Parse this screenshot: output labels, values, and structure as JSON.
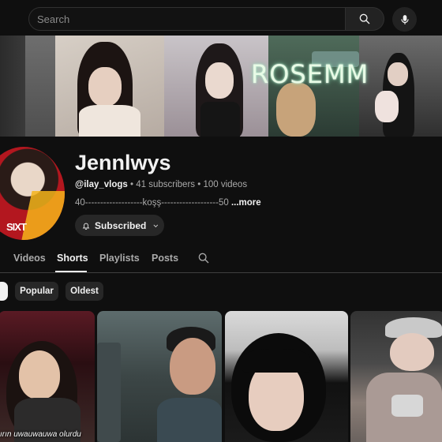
{
  "search": {
    "placeholder": "Search"
  },
  "icons": {
    "search": "search-icon",
    "mic": "mic-icon",
    "bell": "bell-icon",
    "chevron": "chevron-down-icon"
  },
  "banner": {
    "text": "ROSEMM"
  },
  "channel": {
    "name": "Jennlwys",
    "handle": "@ilay_vlogs",
    "stats": " • 41 subscribers • 100 videos",
    "description": "40-------------------koşş-------------------50 ",
    "more_label": "...more",
    "avatar_logo": "SIXT"
  },
  "subscribe": {
    "label": "Subscribed"
  },
  "tabs": [
    {
      "label": "Videos",
      "active": false
    },
    {
      "label": "Shorts",
      "active": true
    },
    {
      "label": "Playlists",
      "active": false
    },
    {
      "label": "Posts",
      "active": false
    }
  ],
  "chips": [
    {
      "label": "",
      "selected": true
    },
    {
      "label": "Popular",
      "selected": false
    },
    {
      "label": "Oldest",
      "selected": false
    }
  ],
  "shorts": [
    {
      "caption": "ırın uwauwauwa olurdu"
    },
    {
      "caption": ""
    },
    {
      "caption": ""
    },
    {
      "caption": ""
    }
  ],
  "colors": {
    "background": "#0f0f0f",
    "text": "#f1f1f1",
    "muted": "#aaaaaa",
    "chip": "#272727"
  }
}
